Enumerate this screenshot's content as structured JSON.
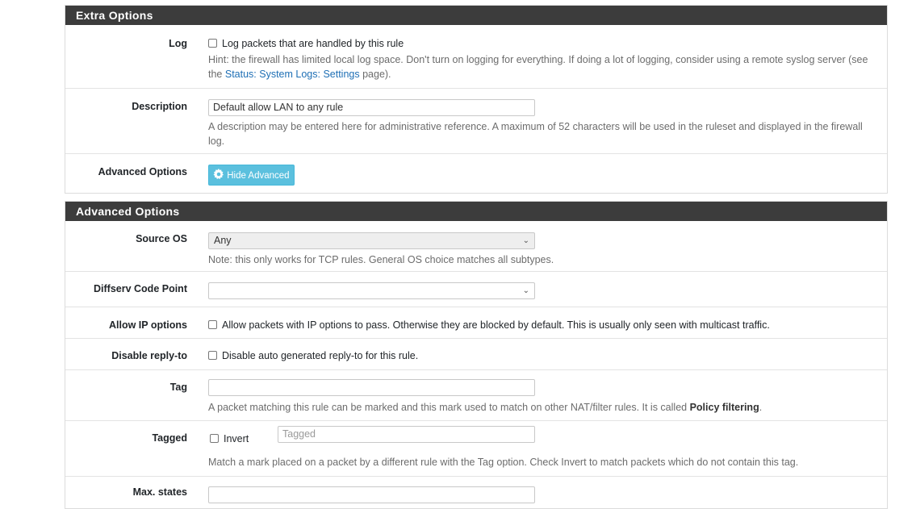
{
  "extra": {
    "heading": "Extra Options",
    "log": {
      "label": "Log",
      "checkbox_label": "Log packets that are handled by this rule",
      "hint_before": "Hint: the firewall has limited local log space. Don't turn on logging for everything. If doing a lot of logging, consider using a remote syslog server (see the ",
      "hint_link": "Status: System Logs: Settings",
      "hint_after": " page)."
    },
    "description": {
      "label": "Description",
      "value": "Default allow LAN to any rule",
      "help": "A description may be entered here for administrative reference. A maximum of 52 characters will be used in the ruleset and displayed in the firewall log."
    },
    "advanced": {
      "label": "Advanced Options",
      "button_label": "Hide Advanced"
    }
  },
  "advanced": {
    "heading": "Advanced Options",
    "source_os": {
      "label": "Source OS",
      "selected": "Any",
      "help": "Note: this only works for TCP rules. General OS choice matches all subtypes."
    },
    "diffserv": {
      "label": "Diffserv Code Point",
      "selected": ""
    },
    "allow_ip": {
      "label": "Allow IP options",
      "checkbox_label": "Allow packets with IP options to pass. Otherwise they are blocked by default. This is usually only seen with multicast traffic."
    },
    "reply_to": {
      "label": "Disable reply-to",
      "checkbox_label": "Disable auto generated reply-to for this rule."
    },
    "tag": {
      "label": "Tag",
      "value": "",
      "help_before": "A packet matching this rule can be marked and this mark used to match on other NAT/filter rules. It is called ",
      "help_bold": "Policy filtering",
      "help_after": "."
    },
    "tagged": {
      "label": "Tagged",
      "invert_label": "Invert",
      "placeholder": "Tagged",
      "help": "Match a mark placed on a packet by a different rule with the Tag option. Check Invert to match packets which do not contain this tag."
    },
    "max_states": {
      "label": "Max. states"
    }
  },
  "colors": {
    "panel_heading_bg": "#3c3c3c",
    "link": "#1e6fb5",
    "button_info": "#5bc0de"
  },
  "icons": {
    "gear": "gear-icon",
    "chevron": "chevron-down-icon"
  }
}
